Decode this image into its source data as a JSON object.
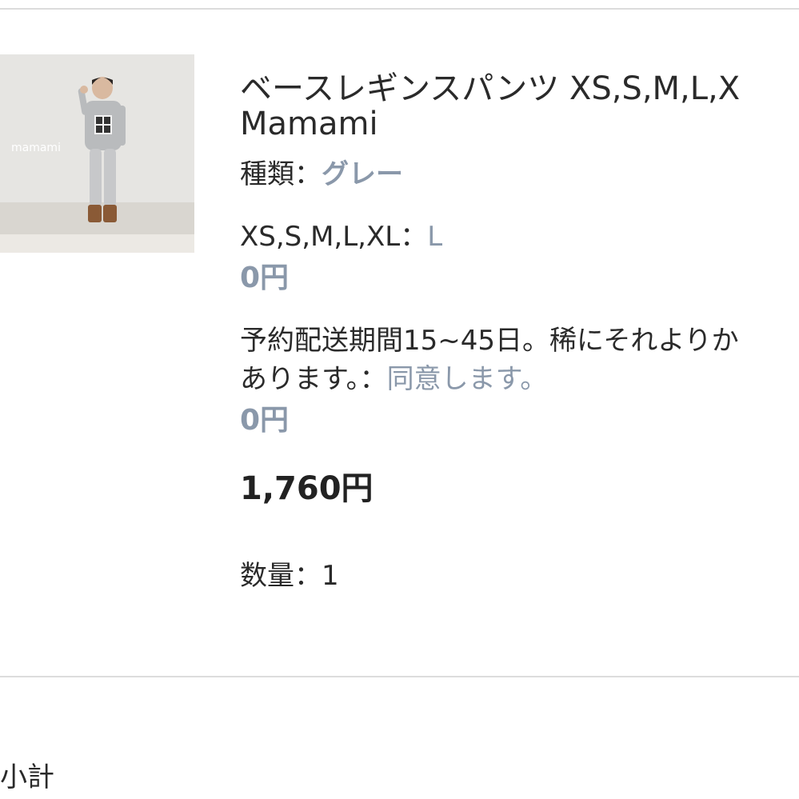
{
  "product": {
    "image_watermark": "mamami",
    "title": "ベースレギンスパンツ XS,S,M,L,X",
    "brand": "Mamami",
    "option_kind_label": "種類：",
    "option_kind_value": "グレー",
    "option_size_label": "XS,S,M,L,XL：",
    "option_size_value": "L",
    "option_price_1": "0円",
    "note_line1": "予約配送期間15~45日。稀にそれよりか",
    "note_line2_label": "あります。：",
    "note_line2_value": "同意します。",
    "option_price_2": "0円",
    "total_price": "1,760円",
    "quantity_label": "数量：",
    "quantity_value": "1"
  },
  "footer": {
    "subtotal_label": "小計"
  },
  "colors": {
    "accent_gray_blue": "#8a98aa",
    "divider": "#dcdcdc",
    "text": "#2a2a2a"
  }
}
